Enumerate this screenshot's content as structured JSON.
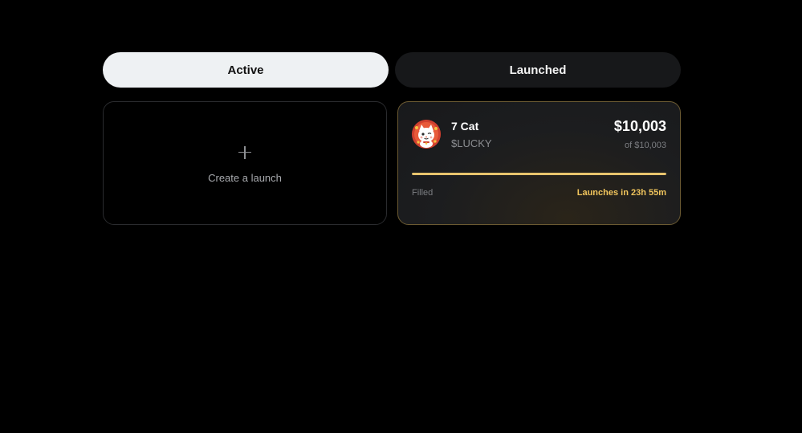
{
  "tabs": {
    "active_label": "Active",
    "launched_label": "Launched"
  },
  "create_card": {
    "label": "Create a launch",
    "icon": "plus-icon"
  },
  "launch": {
    "name": "7 Cat",
    "ticker": "$LUCKY",
    "amount": "$10,003",
    "goal": "of $10,003",
    "progress_fraction": 1.0,
    "filled_label": "Filled",
    "countdown": "Launches in 23h 55m",
    "avatar_icon": "lucky-cat-avatar-icon"
  },
  "colors": {
    "background": "#000000",
    "active_tab_bg": "#eef1f3",
    "inactive_tab_bg": "#17181a",
    "accent_gold": "#e8c46d",
    "countdown_text": "#f0c45c",
    "launch_card_border": "#6b5a32"
  }
}
